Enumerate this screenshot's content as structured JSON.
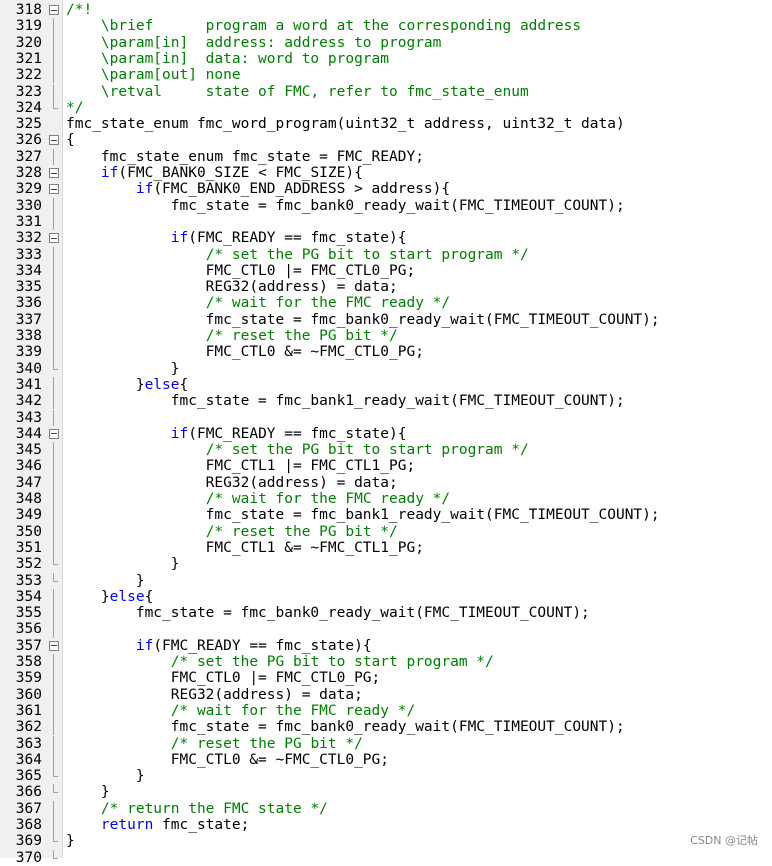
{
  "editor": {
    "lines": [
      {
        "n": "318",
        "fold": "box",
        "segs": [
          {
            "t": "/*!",
            "c": "comment"
          }
        ]
      },
      {
        "n": "319",
        "fold": "vline",
        "segs": [
          {
            "t": "    \\brief      program a word at the corresponding address",
            "c": "comment"
          }
        ]
      },
      {
        "n": "320",
        "fold": "vline",
        "segs": [
          {
            "t": "    \\param[in]  address: address to program",
            "c": "comment"
          }
        ]
      },
      {
        "n": "321",
        "fold": "vline",
        "segs": [
          {
            "t": "    \\param[in]  data: word to program",
            "c": "comment"
          }
        ]
      },
      {
        "n": "322",
        "fold": "vline",
        "segs": [
          {
            "t": "    \\param[out] none",
            "c": "comment"
          }
        ]
      },
      {
        "n": "323",
        "fold": "vline",
        "segs": [
          {
            "t": "    \\retval     state of FMC, refer to fmc_state_enum",
            "c": "comment"
          }
        ]
      },
      {
        "n": "324",
        "fold": "end",
        "segs": [
          {
            "t": "*/",
            "c": "comment"
          }
        ]
      },
      {
        "n": "325",
        "fold": "none",
        "segs": [
          {
            "t": "fmc_state_enum fmc_word_program(uint32_t address, uint32_t data)",
            "c": "plain"
          }
        ]
      },
      {
        "n": "326",
        "fold": "box",
        "segs": [
          {
            "t": "{",
            "c": "plain"
          }
        ]
      },
      {
        "n": "327",
        "fold": "vline",
        "segs": [
          {
            "t": "    fmc_state_enum fmc_state = FMC_READY;",
            "c": "plain"
          }
        ]
      },
      {
        "n": "328",
        "fold": "box",
        "segs": [
          {
            "t": "    ",
            "c": "plain"
          },
          {
            "t": "if",
            "c": "keyword"
          },
          {
            "t": "(FMC_BANK0_SIZE < FMC_SIZE){",
            "c": "plain"
          }
        ]
      },
      {
        "n": "329",
        "fold": "box",
        "segs": [
          {
            "t": "        ",
            "c": "plain"
          },
          {
            "t": "if",
            "c": "keyword"
          },
          {
            "t": "(FMC_BANK0_END_ADDRESS > address){",
            "c": "plain"
          }
        ]
      },
      {
        "n": "330",
        "fold": "vline",
        "segs": [
          {
            "t": "            fmc_state = fmc_bank0_ready_wait(FMC_TIMEOUT_COUNT);",
            "c": "plain"
          }
        ]
      },
      {
        "n": "331",
        "fold": "vline",
        "segs": [
          {
            "t": "",
            "c": "plain"
          }
        ]
      },
      {
        "n": "332",
        "fold": "box",
        "segs": [
          {
            "t": "            ",
            "c": "plain"
          },
          {
            "t": "if",
            "c": "keyword"
          },
          {
            "t": "(FMC_READY == fmc_state){",
            "c": "plain"
          }
        ]
      },
      {
        "n": "333",
        "fold": "vline",
        "segs": [
          {
            "t": "                ",
            "c": "plain"
          },
          {
            "t": "/* set the PG bit to start program */",
            "c": "comment"
          }
        ]
      },
      {
        "n": "334",
        "fold": "vline",
        "segs": [
          {
            "t": "                FMC_CTL0 |= FMC_CTL0_PG;",
            "c": "plain"
          }
        ]
      },
      {
        "n": "335",
        "fold": "vline",
        "segs": [
          {
            "t": "                REG32(address) = data;",
            "c": "plain"
          }
        ]
      },
      {
        "n": "336",
        "fold": "vline",
        "segs": [
          {
            "t": "                ",
            "c": "plain"
          },
          {
            "t": "/* wait for the FMC ready */",
            "c": "comment"
          }
        ]
      },
      {
        "n": "337",
        "fold": "vline",
        "segs": [
          {
            "t": "                fmc_state = fmc_bank0_ready_wait(FMC_TIMEOUT_COUNT);",
            "c": "plain"
          }
        ]
      },
      {
        "n": "338",
        "fold": "vline",
        "segs": [
          {
            "t": "                ",
            "c": "plain"
          },
          {
            "t": "/* reset the PG bit */",
            "c": "comment"
          }
        ]
      },
      {
        "n": "339",
        "fold": "vline",
        "segs": [
          {
            "t": "                FMC_CTL0 &= ~FMC_CTL0_PG;",
            "c": "plain"
          }
        ]
      },
      {
        "n": "340",
        "fold": "end",
        "segs": [
          {
            "t": "            }",
            "c": "plain"
          }
        ]
      },
      {
        "n": "341",
        "fold": "vline",
        "segs": [
          {
            "t": "        }",
            "c": "plain"
          },
          {
            "t": "else",
            "c": "keyword"
          },
          {
            "t": "{",
            "c": "plain"
          }
        ]
      },
      {
        "n": "342",
        "fold": "vline",
        "segs": [
          {
            "t": "            fmc_state = fmc_bank1_ready_wait(FMC_TIMEOUT_COUNT);",
            "c": "plain"
          }
        ]
      },
      {
        "n": "343",
        "fold": "vline",
        "segs": [
          {
            "t": "",
            "c": "plain"
          }
        ]
      },
      {
        "n": "344",
        "fold": "box",
        "segs": [
          {
            "t": "            ",
            "c": "plain"
          },
          {
            "t": "if",
            "c": "keyword"
          },
          {
            "t": "(FMC_READY == fmc_state){",
            "c": "plain"
          }
        ]
      },
      {
        "n": "345",
        "fold": "vline",
        "segs": [
          {
            "t": "                ",
            "c": "plain"
          },
          {
            "t": "/* set the PG bit to start program */",
            "c": "comment"
          }
        ]
      },
      {
        "n": "346",
        "fold": "vline",
        "segs": [
          {
            "t": "                FMC_CTL1 |= FMC_CTL1_PG;",
            "c": "plain"
          }
        ]
      },
      {
        "n": "347",
        "fold": "vline",
        "segs": [
          {
            "t": "                REG32(address) = data;",
            "c": "plain"
          }
        ]
      },
      {
        "n": "348",
        "fold": "vline",
        "segs": [
          {
            "t": "                ",
            "c": "plain"
          },
          {
            "t": "/* wait for the FMC ready */",
            "c": "comment"
          }
        ]
      },
      {
        "n": "349",
        "fold": "vline",
        "segs": [
          {
            "t": "                fmc_state = fmc_bank1_ready_wait(FMC_TIMEOUT_COUNT);",
            "c": "plain"
          }
        ]
      },
      {
        "n": "350",
        "fold": "vline",
        "segs": [
          {
            "t": "                ",
            "c": "plain"
          },
          {
            "t": "/* reset the PG bit */",
            "c": "comment"
          }
        ]
      },
      {
        "n": "351",
        "fold": "vline",
        "segs": [
          {
            "t": "                FMC_CTL1 &= ~FMC_CTL1_PG;",
            "c": "plain"
          }
        ]
      },
      {
        "n": "352",
        "fold": "end",
        "segs": [
          {
            "t": "            }",
            "c": "plain"
          }
        ]
      },
      {
        "n": "353",
        "fold": "end",
        "segs": [
          {
            "t": "        }",
            "c": "plain"
          }
        ]
      },
      {
        "n": "354",
        "fold": "vline",
        "segs": [
          {
            "t": "    }",
            "c": "plain"
          },
          {
            "t": "else",
            "c": "keyword"
          },
          {
            "t": "{",
            "c": "plain"
          }
        ]
      },
      {
        "n": "355",
        "fold": "vline",
        "segs": [
          {
            "t": "        fmc_state = fmc_bank0_ready_wait(FMC_TIMEOUT_COUNT);",
            "c": "plain"
          }
        ]
      },
      {
        "n": "356",
        "fold": "vline",
        "segs": [
          {
            "t": "",
            "c": "plain"
          }
        ]
      },
      {
        "n": "357",
        "fold": "box",
        "segs": [
          {
            "t": "        ",
            "c": "plain"
          },
          {
            "t": "if",
            "c": "keyword"
          },
          {
            "t": "(FMC_READY == fmc_state){",
            "c": "plain"
          }
        ]
      },
      {
        "n": "358",
        "fold": "vline",
        "segs": [
          {
            "t": "            ",
            "c": "plain"
          },
          {
            "t": "/* set the PG bit to start program */",
            "c": "comment"
          }
        ]
      },
      {
        "n": "359",
        "fold": "vline",
        "segs": [
          {
            "t": "            FMC_CTL0 |= FMC_CTL0_PG;",
            "c": "plain"
          }
        ]
      },
      {
        "n": "360",
        "fold": "vline",
        "segs": [
          {
            "t": "            REG32(address) = data;",
            "c": "plain"
          }
        ]
      },
      {
        "n": "361",
        "fold": "vline",
        "segs": [
          {
            "t": "            ",
            "c": "plain"
          },
          {
            "t": "/* wait for the FMC ready */",
            "c": "comment"
          }
        ]
      },
      {
        "n": "362",
        "fold": "vline",
        "segs": [
          {
            "t": "            fmc_state = fmc_bank0_ready_wait(FMC_TIMEOUT_COUNT);",
            "c": "plain"
          }
        ]
      },
      {
        "n": "363",
        "fold": "vline",
        "segs": [
          {
            "t": "            ",
            "c": "plain"
          },
          {
            "t": "/* reset the PG bit */",
            "c": "comment"
          }
        ]
      },
      {
        "n": "364",
        "fold": "vline",
        "segs": [
          {
            "t": "            FMC_CTL0 &= ~FMC_CTL0_PG;",
            "c": "plain"
          }
        ]
      },
      {
        "n": "365",
        "fold": "end",
        "segs": [
          {
            "t": "        }",
            "c": "plain"
          }
        ]
      },
      {
        "n": "366",
        "fold": "end",
        "segs": [
          {
            "t": "    }",
            "c": "plain"
          }
        ]
      },
      {
        "n": "367",
        "fold": "vline",
        "segs": [
          {
            "t": "    ",
            "c": "plain"
          },
          {
            "t": "/* return the FMC state */",
            "c": "comment"
          }
        ]
      },
      {
        "n": "368",
        "fold": "vline",
        "segs": [
          {
            "t": "    ",
            "c": "plain"
          },
          {
            "t": "return",
            "c": "keyword"
          },
          {
            "t": " fmc_state;",
            "c": "plain"
          }
        ]
      },
      {
        "n": "369",
        "fold": "end",
        "segs": [
          {
            "t": "}",
            "c": "plain"
          }
        ]
      },
      {
        "n": "370",
        "fold": "end",
        "segs": [
          {
            "t": "",
            "c": "plain"
          }
        ]
      }
    ]
  },
  "watermark": "CSDN @记帖",
  "colors": {
    "comment": "#008000",
    "keyword": "#0000ff",
    "plain": "#000000"
  }
}
